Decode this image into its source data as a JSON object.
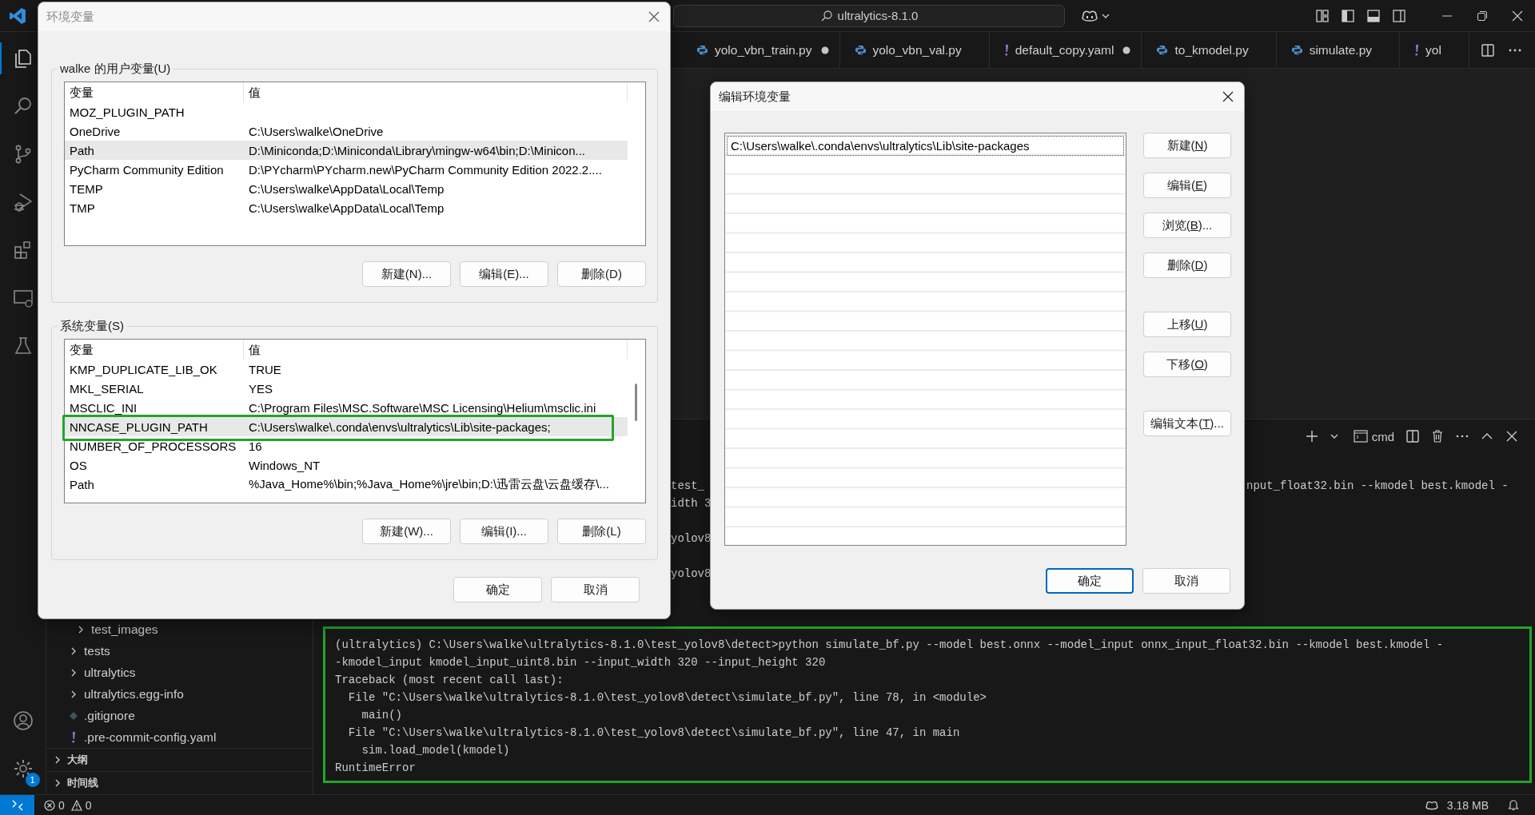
{
  "vscode": {
    "search": "ultralytics-8.1.0",
    "tabs": [
      {
        "label": "yolo_vbn_train.py",
        "kind": "python",
        "modified": true
      },
      {
        "label": "yolo_vbn_val.py",
        "kind": "python",
        "modified": false
      },
      {
        "label": "default_copy.yaml",
        "kind": "yaml",
        "modified": true
      },
      {
        "label": "to_kmodel.py",
        "kind": "python",
        "modified": false
      },
      {
        "label": "simulate.py",
        "kind": "python",
        "modified": false
      },
      {
        "label": "yol",
        "kind": "yaml",
        "modified": false
      }
    ],
    "settings_badge": "1",
    "explorer": {
      "tree": [
        {
          "children": [
            {
              "label": "test_images",
              "kind": "folder"
            }
          ]
        },
        {
          "label": "tests",
          "kind": "folder"
        },
        {
          "label": "ultralytics",
          "kind": "folder"
        },
        {
          "label": "ultralytics.egg-info",
          "kind": "folder"
        },
        {
          "label": ".gitignore",
          "kind": "git"
        },
        {
          "label": ".pre-commit-config.yaml",
          "kind": "yaml"
        }
      ],
      "sections": [
        {
          "label": "大纲",
          "expanded": false
        },
        {
          "label": "时间线",
          "expanded": false
        }
      ]
    },
    "panel": {
      "profile": "cmd",
      "history": [
        {
          "left": "test_",
          "right": "nput_float32.bin --kmodel best.kmodel -"
        },
        {
          "left": "idth 3"
        },
        {
          "left": "yolov8"
        },
        {
          "left": "yolov8"
        }
      ],
      "output": [
        "(ultralytics) C:\\Users\\walke\\ultralytics-8.1.0\\test_yolov8\\detect>python simulate_bf.py --model best.onnx --model_input onnx_input_float32.bin --kmodel best.kmodel -",
        "-kmodel_input kmodel_input_uint8.bin --input_width 320 --input_height 320",
        "Traceback (most recent call last):",
        "  File \"C:\\Users\\walke\\ultralytics-8.1.0\\test_yolov8\\detect\\simulate_bf.py\", line 78, in <module>",
        "    main()",
        "  File \"C:\\Users\\walke\\ultralytics-8.1.0\\test_yolov8\\detect\\simulate_bf.py\", line 47, in main",
        "    sim.load_model(kmodel)",
        "RuntimeError"
      ]
    },
    "status_bar": {
      "errors": "0",
      "warnings": "0",
      "memory": "3.18 MB"
    }
  },
  "env_dialog": {
    "title": "环境变量",
    "active": false,
    "groups": [
      {
        "title": "walke 的用户变量(U)",
        "columns": [
          "变量",
          "值"
        ],
        "rows": [
          {
            "name": "MOZ_PLUGIN_PATH",
            "selected": false
          },
          {
            "name": "OneDrive",
            "value": "C:\\Users\\walke\\OneDrive",
            "selected": false
          },
          {
            "name": "Path",
            "value": "D:\\Miniconda;D:\\Miniconda\\Library\\mingw-w64\\bin;D:\\Minicon...",
            "selected": true
          },
          {
            "name": "PyCharm Community Edition",
            "value": "D:\\PYcharm\\PYcharm.new\\PyCharm Community Edition 2022.2....",
            "selected": false
          },
          {
            "name": "TEMP",
            "value": "C:\\Users\\walke\\AppData\\Local\\Temp",
            "selected": false
          },
          {
            "name": "TMP",
            "value": "C:\\Users\\walke\\AppData\\Local\\Temp",
            "selected": false
          }
        ],
        "buttons": [
          "新建(N)...",
          "编辑(E)...",
          "删除(D)"
        ]
      },
      {
        "title": "系统变量(S)",
        "columns": [
          "变量",
          "值"
        ],
        "rows": [
          {
            "name": "KMP_DUPLICATE_LIB_OK",
            "value": "TRUE",
            "selected": false
          },
          {
            "name": "MKL_SERIAL",
            "value": "YES",
            "selected": false
          },
          {
            "name": "MSCLIC_INI",
            "value": "C:\\Program Files\\MSC.Software\\MSC Licensing\\Helium\\msclic.ini",
            "selected": false
          },
          {
            "name": "NNCASE_PLUGIN_PATH",
            "value": "C:\\Users\\walke\\.conda\\envs\\ultralytics\\Lib\\site-packages;",
            "selected": true
          },
          {
            "name": "NUMBER_OF_PROCESSORS",
            "value": "16",
            "selected": false
          },
          {
            "name": "OS",
            "value": "Windows_NT",
            "selected": false
          },
          {
            "name": "Path",
            "value": "%Java_Home%\\bin;%Java_Home%\\jre\\bin;D:\\迅雷云盘\\云盘缓存\\...",
            "selected": false
          }
        ],
        "buttons": [
          "新建(W)...",
          "编辑(I)...",
          "删除(L)"
        ]
      }
    ],
    "footer": [
      {
        "label": "确定",
        "default": false
      },
      {
        "label": "取消",
        "default": false
      }
    ]
  },
  "edit_dialog": {
    "title": "编辑环境变量",
    "active": true,
    "entries": [
      {
        "text": "C:\\Users\\walke\\.conda\\envs\\ultralytics\\Lib\\site-packages",
        "focused": true
      }
    ],
    "button_groups": [
      [
        {
          "before": "新建(",
          "key": "N",
          "after": ")"
        },
        {
          "before": "编辑(",
          "key": "E",
          "after": ")"
        },
        {
          "before": "浏览(",
          "key": "B",
          "after": ")..."
        },
        {
          "before": "删除(",
          "key": "D",
          "after": ")"
        }
      ],
      [
        {
          "before": "上移(",
          "key": "U",
          "after": ")"
        },
        {
          "before": "下移(",
          "key": "O",
          "after": ")"
        }
      ],
      [
        {
          "before": "编辑文本(",
          "key": "T",
          "after": ")..."
        }
      ]
    ],
    "footer": [
      {
        "label": "确定",
        "default": true
      },
      {
        "label": "取消",
        "default": false
      }
    ]
  }
}
